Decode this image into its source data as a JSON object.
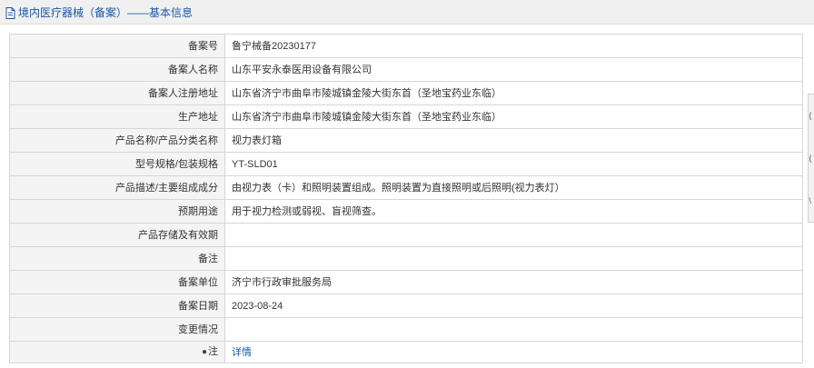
{
  "header": {
    "title": "境内医疗器械（备案）——基本信息"
  },
  "record": [
    {
      "label": "备案号",
      "value": "鲁宁械备20230177"
    },
    {
      "label": "备案人名称",
      "value": "山东平安永泰医用设备有限公司"
    },
    {
      "label": "备案人注册地址",
      "value": "山东省济宁市曲阜市陵城镇金陵大街东首（圣地宝药业东临）"
    },
    {
      "label": "生产地址",
      "value": "山东省济宁市曲阜市陵城镇金陵大街东首（圣地宝药业东临）"
    },
    {
      "label": "产品名称/产品分类名称",
      "value": "视力表灯箱"
    },
    {
      "label": "型号规格/包装规格",
      "value": "YT-SLD01"
    },
    {
      "label": "产品描述/主要组成成分",
      "value": "由视力表（卡）和照明装置组成。照明装置为直接照明或后照明(视力表灯）"
    },
    {
      "label": "预期用途",
      "value": "用于视力检测或弱视、盲视筛查。"
    },
    {
      "label": "产品存储及有效期",
      "value": ""
    },
    {
      "label": "备注",
      "value": ""
    },
    {
      "label": "备案单位",
      "value": "济宁市行政审批服务局"
    },
    {
      "label": "备案日期",
      "value": "2023-08-24"
    },
    {
      "label": "变更情况",
      "value": ""
    }
  ],
  "note": {
    "label": "注",
    "link_text": "详情",
    "icon": "lightbulb-icon"
  },
  "side_tab": {
    "glyphs": [
      "(",
      "(",
      "\\"
    ]
  },
  "colors": {
    "link": "#1a57a4",
    "label_bg": "#f4f4f4",
    "border": "#d6d6d6",
    "header_bg": "#f0f0f0"
  }
}
